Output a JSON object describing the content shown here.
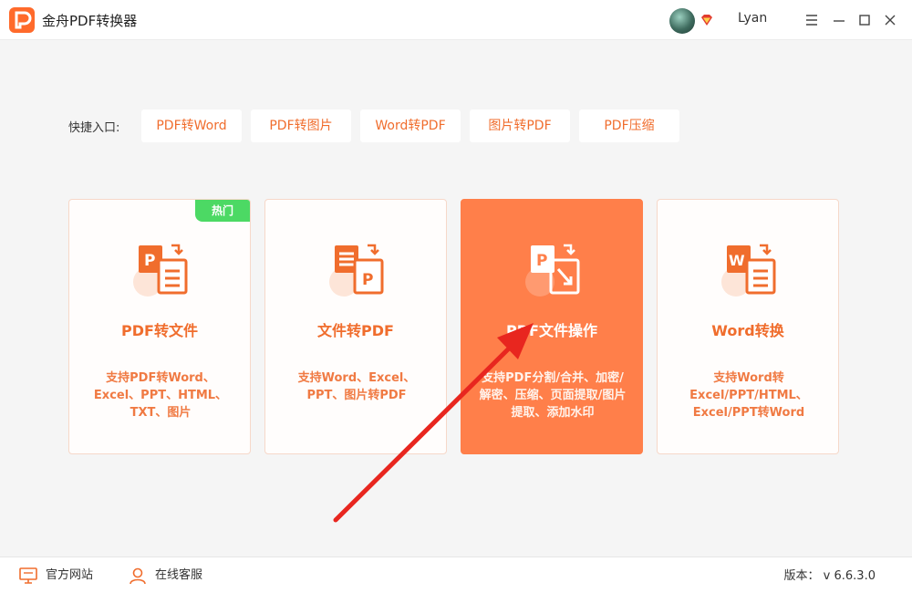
{
  "app": {
    "title": "金舟PDF转换器",
    "user_name": "Lyan"
  },
  "quick_entry": {
    "label": "快捷入口:",
    "buttons": [
      {
        "label": "PDF转Word"
      },
      {
        "label": "PDF转图片"
      },
      {
        "label": "Word转PDF"
      },
      {
        "label": "图片转PDF"
      },
      {
        "label": "PDF压缩"
      }
    ]
  },
  "cards": [
    {
      "title": "PDF转文件",
      "desc": "支持PDF转Word、Excel、PPT、HTML、TXT、图片",
      "badge": "热门",
      "icon": "pdf-to-file-icon"
    },
    {
      "title": "文件转PDF",
      "desc": "支持Word、Excel、PPT、图片转PDF",
      "icon": "file-to-pdf-icon"
    },
    {
      "title": "PDF文件操作",
      "desc": "支持PDF分割/合并、加密/解密、压缩、页面提取/图片提取、添加水印",
      "icon": "pdf-operations-icon",
      "active": true
    },
    {
      "title": "Word转换",
      "desc": "支持Word转Excel/PPT/HTML、Excel/PPT转Word",
      "icon": "word-convert-icon"
    }
  ],
  "footer": {
    "website_label": "官方网站",
    "service_label": "在线客服",
    "version_text": "版本： v 6.6.3.0"
  },
  "colors": {
    "accent": "#f06d2d",
    "active_card": "#ff7f4a",
    "hot_badge": "#4cd964",
    "annotation_arrow": "#e8261f"
  }
}
